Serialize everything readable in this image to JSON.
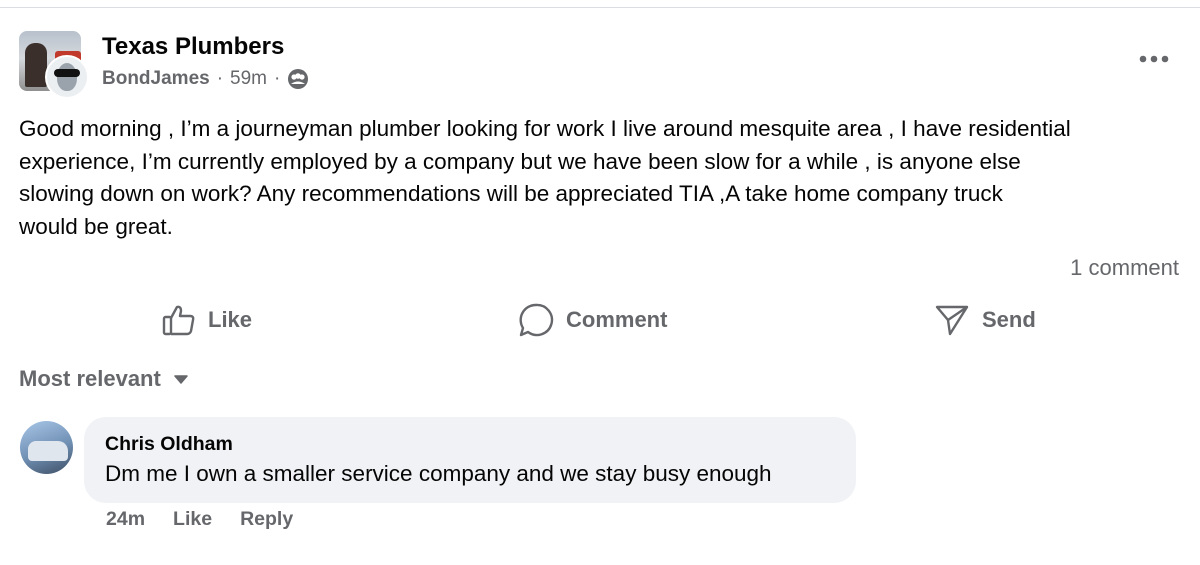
{
  "post": {
    "group_name": "Texas Plumbers",
    "author": "BondJames",
    "separator": "·",
    "time": "59m",
    "audience_icon": "group-audience-icon",
    "more_icon": "more-options-icon",
    "text": "Good morning , I’m a journeyman plumber looking for work I live around mesquite area , I have residential\nexperience, I’m currently employed by a company but we have been slow for a while , is anyone else\nslowing down on work? Any recommendations will be appreciated TIA ,A take home company truck\nwould be great.",
    "comment_count": "1 comment"
  },
  "actions": {
    "like": "Like",
    "comment": "Comment",
    "send": "Send"
  },
  "sort": {
    "label": "Most relevant"
  },
  "comments": [
    {
      "name": "Chris Oldham",
      "text": "Dm me I own a smaller service company and we stay busy enough",
      "time": "24m",
      "like": "Like",
      "reply": "Reply"
    }
  ],
  "colors": {
    "text_primary": "#050505",
    "text_secondary": "#65676b",
    "bubble_bg": "#f0f2f5",
    "divider": "#dadde1"
  }
}
